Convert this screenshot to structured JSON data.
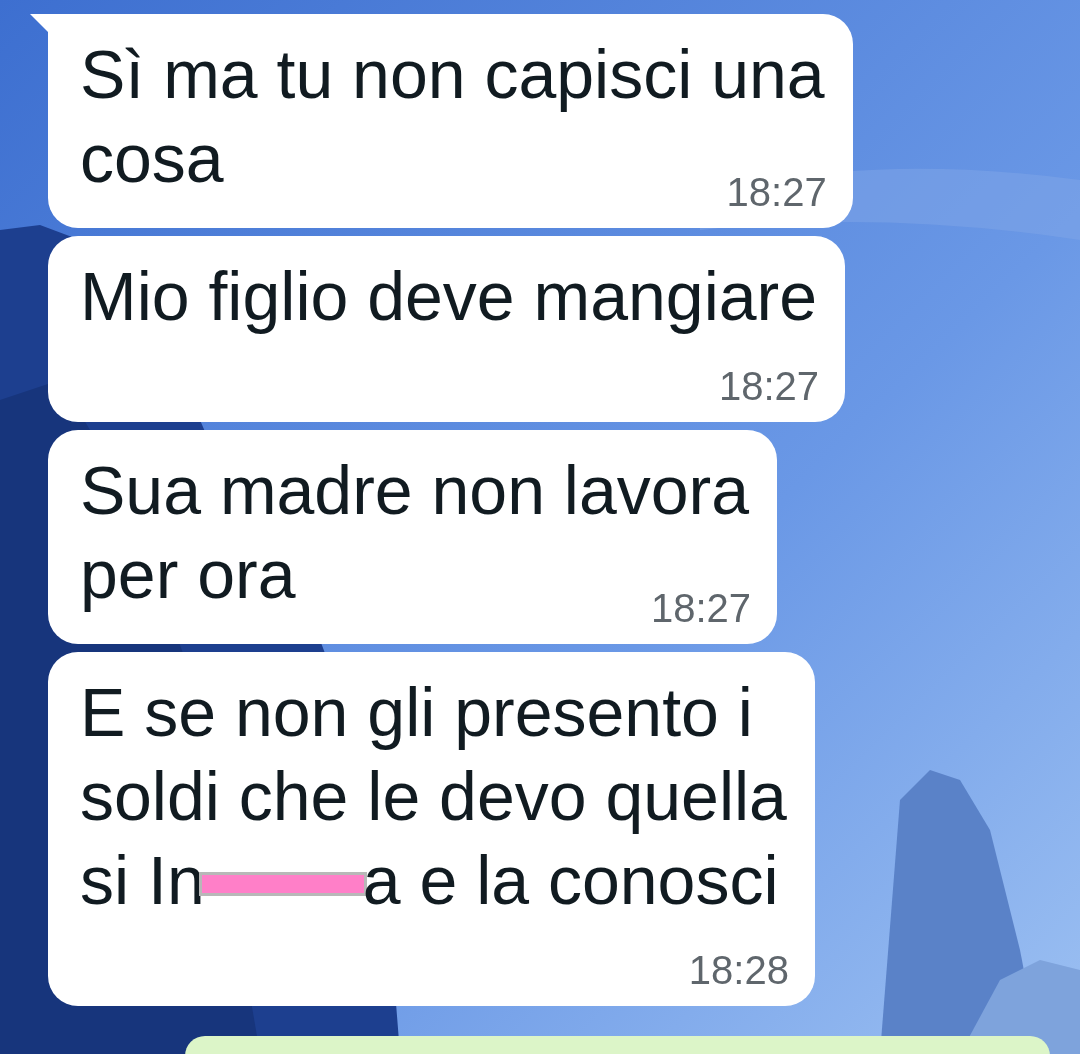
{
  "messages": [
    {
      "kind": "incoming",
      "tail": true,
      "lines": [
        {
          "segments": [
            {
              "kind": "text",
              "text": "Sì ma tu non capisci una"
            }
          ]
        },
        {
          "segments": [
            {
              "kind": "text",
              "text": "cosa"
            }
          ]
        }
      ],
      "time": "18:27"
    },
    {
      "kind": "incoming",
      "tail": false,
      "lines": [
        {
          "segments": [
            {
              "kind": "text",
              "text": "Mio figlio deve mangiare"
            }
          ]
        }
      ],
      "time": "18:27"
    },
    {
      "kind": "incoming",
      "tail": false,
      "lines": [
        {
          "segments": [
            {
              "kind": "text",
              "text": "Sua madre non lavora"
            }
          ]
        },
        {
          "segments": [
            {
              "kind": "text",
              "text": "per ora"
            }
          ]
        }
      ],
      "time": "18:27"
    },
    {
      "kind": "incoming",
      "tail": false,
      "lines": [
        {
          "segments": [
            {
              "kind": "text",
              "text": "E se non gli presento i"
            }
          ]
        },
        {
          "segments": [
            {
              "kind": "text",
              "text": "soldi che le devo quella"
            }
          ]
        },
        {
          "segments": [
            {
              "kind": "text",
              "text": "si In"
            },
            {
              "kind": "redaction"
            },
            {
              "kind": "text",
              "text": "a e la conosci"
            }
          ]
        }
      ],
      "time": "18:28"
    },
    {
      "kind": "outgoing"
    }
  ]
}
